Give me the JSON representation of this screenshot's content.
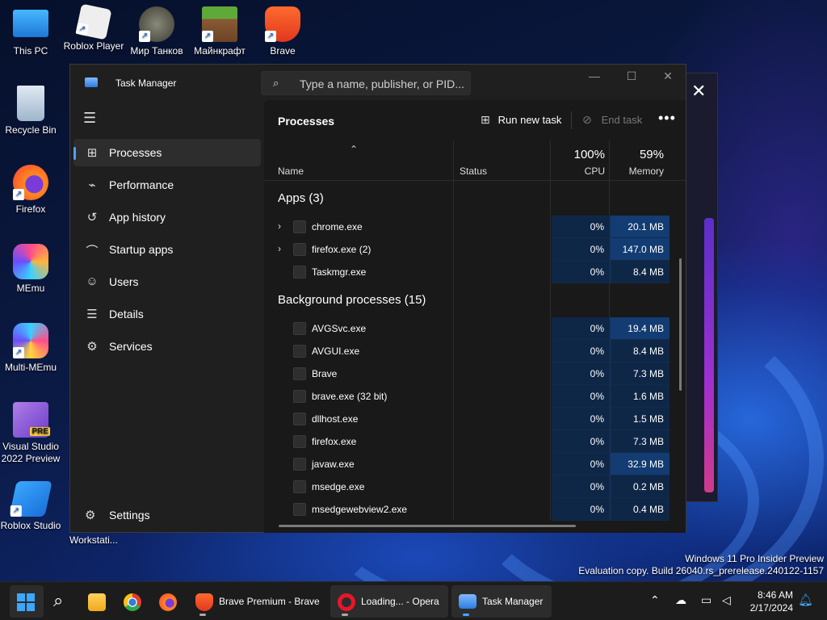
{
  "desktop": {
    "icons": [
      {
        "label": "This PC"
      },
      {
        "label": "Roblox Player"
      },
      {
        "label": "Мир Танков"
      },
      {
        "label": "Майнкрафт"
      },
      {
        "label": "Brave"
      },
      {
        "label": "Recycle Bin"
      },
      {
        "label": "Firefox"
      },
      {
        "label": "MEmu"
      },
      {
        "label": "Multi-MEmu"
      },
      {
        "label": "Visual Studio 2022 Preview"
      },
      {
        "label": "Roblox Studio"
      }
    ],
    "partial_label": "Workstati...",
    "watermark_line1": "Windows 11 Pro Insider Preview",
    "watermark_line2": "Evaluation copy. Build 26040.rs_prerelease.240122-1157"
  },
  "task_manager": {
    "title": "Task Manager",
    "search_placeholder": "Type a name, publisher, or PID...",
    "nav": [
      {
        "label": "Processes",
        "icon": "processes-icon",
        "active": true
      },
      {
        "label": "Performance",
        "icon": "performance-icon"
      },
      {
        "label": "App history",
        "icon": "app-history-icon"
      },
      {
        "label": "Startup apps",
        "icon": "startup-apps-icon"
      },
      {
        "label": "Users",
        "icon": "users-icon"
      },
      {
        "label": "Details",
        "icon": "details-icon"
      },
      {
        "label": "Services",
        "icon": "services-icon"
      }
    ],
    "settings_label": "Settings",
    "page_title": "Processes",
    "run_new_task": "Run new task",
    "end_task": "End task",
    "columns": {
      "name": "Name",
      "status": "Status",
      "cpu_pct": "100%",
      "cpu": "CPU",
      "mem_pct": "59%",
      "memory": "Memory"
    },
    "groups": [
      {
        "label": "Apps (3)",
        "rows": [
          {
            "name": "chrome.exe",
            "expandable": true,
            "cpu": "0%",
            "memory": "20.1 MB",
            "hot": true
          },
          {
            "name": "firefox.exe (2)",
            "expandable": true,
            "cpu": "0%",
            "memory": "147.0 MB",
            "hot": true
          },
          {
            "name": "Taskmgr.exe",
            "expandable": false,
            "cpu": "0%",
            "memory": "8.4 MB",
            "hot": false
          }
        ]
      },
      {
        "label": "Background processes (15)",
        "rows": [
          {
            "name": "AVGSvc.exe",
            "expandable": false,
            "cpu": "0%",
            "memory": "19.4 MB",
            "hot": true
          },
          {
            "name": "AVGUI.exe",
            "expandable": false,
            "cpu": "0%",
            "memory": "8.4 MB",
            "hot": false
          },
          {
            "name": "Brave",
            "expandable": false,
            "cpu": "0%",
            "memory": "7.3 MB",
            "hot": false
          },
          {
            "name": "brave.exe (32 bit)",
            "expandable": false,
            "cpu": "0%",
            "memory": "1.6 MB",
            "hot": false
          },
          {
            "name": "dllhost.exe",
            "expandable": false,
            "cpu": "0%",
            "memory": "1.5 MB",
            "hot": false
          },
          {
            "name": "firefox.exe",
            "expandable": false,
            "cpu": "0%",
            "memory": "7.3 MB",
            "hot": false
          },
          {
            "name": "javaw.exe",
            "expandable": false,
            "cpu": "0%",
            "memory": "32.9 MB",
            "hot": true
          },
          {
            "name": "msedge.exe",
            "expandable": false,
            "cpu": "0%",
            "memory": "0.2 MB",
            "hot": false
          },
          {
            "name": "msedgewebview2.exe",
            "expandable": false,
            "cpu": "0%",
            "memory": "0.4 MB",
            "hot": false
          }
        ]
      }
    ]
  },
  "taskbar": {
    "brave_label": "Brave Premium - Brave",
    "opera_label": "Loading... - Opera",
    "taskmgr_label": "Task Manager",
    "time": "8:46 AM",
    "date": "2/17/2024"
  },
  "colors": {
    "accent": "#4aa3ff",
    "cpu_cell": "#0f2747",
    "mem_hot": "#123c72"
  }
}
